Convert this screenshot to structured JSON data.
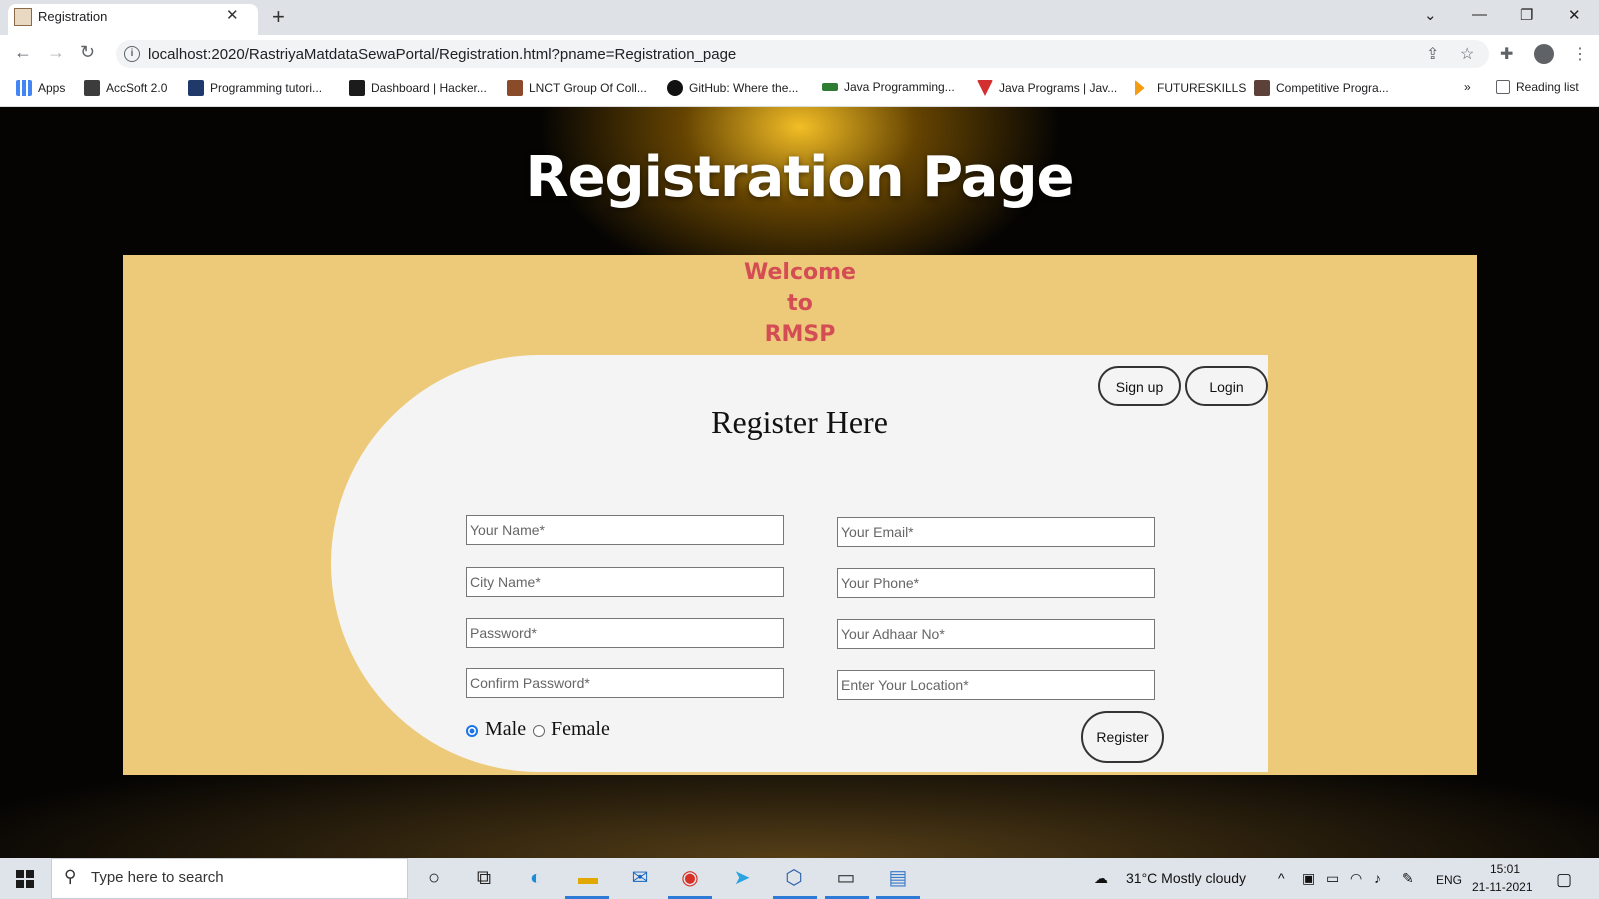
{
  "browser": {
    "tab_title": "Registration",
    "new_tab_label": "+",
    "url": "localhost:2020/RastriyaMatdataSewaPortal/Registration.html?pname=Registration_page",
    "bookmarks": [
      {
        "label": "Apps",
        "icon": "apps-grid-icon",
        "color": "#4285f4"
      },
      {
        "label": "AccSoft 2.0",
        "icon": "accsoft-icon",
        "color": "#3c3c3c"
      },
      {
        "label": "Programming tutori...",
        "icon": "h-icon",
        "color": "#1f3a6a"
      },
      {
        "label": "Dashboard | Hacker...",
        "icon": "hackerrank-icon",
        "color": "#1ba94c"
      },
      {
        "label": "LNCT Group Of Coll...",
        "icon": "lnct-icon",
        "color": "#8a4b2a"
      },
      {
        "label": "GitHub: Where the...",
        "icon": "github-icon",
        "color": "#111111"
      },
      {
        "label": "Java Programming...",
        "icon": "java-icon",
        "color": "#2e7d32"
      },
      {
        "label": "Java Programs | Jav...",
        "icon": "jp-icon",
        "color": "#d32f2f"
      },
      {
        "label": "FUTURESKILLS",
        "icon": "futureskills-icon",
        "color": "#f39c12"
      },
      {
        "label": "Competitive Progra...",
        "icon": "cc-icon",
        "color": "#5d4037"
      }
    ],
    "more_bookmarks": "»",
    "reading_list": "Reading list"
  },
  "page": {
    "heading": "Registration Page",
    "welcome_lines": [
      "Welcome",
      "to",
      "RMSP"
    ],
    "signup_label": "Sign up",
    "login_label": "Login",
    "form_title": "Register Here",
    "fields": {
      "name": "Your Name*",
      "email": "Your Email*",
      "city": "City Name*",
      "phone": "Your Phone*",
      "password": "Password*",
      "adhaar": "Your Adhaar No*",
      "confirm_password": "Confirm Password*",
      "location": "Enter Your Location*"
    },
    "gender": {
      "male": "Male",
      "female": "Female",
      "selected": "Male"
    },
    "register_label": "Register",
    "colors": {
      "panel": "#edc97a",
      "welcome": "#d44d55",
      "card": "#f4f4f4"
    }
  },
  "taskbar": {
    "search_placeholder": "Type here to search",
    "weather": "31°C  Mostly cloudy",
    "language": "ENG",
    "time": "15:01",
    "date": "21-11-2021"
  }
}
